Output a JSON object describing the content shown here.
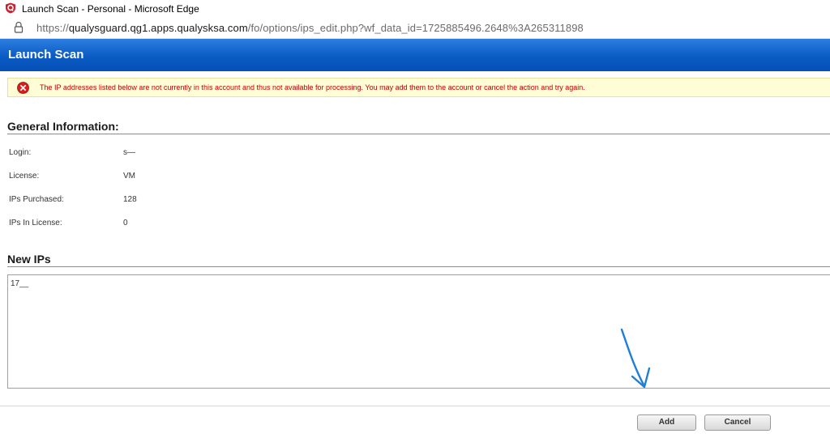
{
  "window": {
    "title": "Launch Scan - Personal - Microsoft Edge",
    "app_icon": "qualys-shield-icon"
  },
  "addressbar": {
    "url_prefix": "https://",
    "url_host": "qualysguard.qg1.apps.qualysksa.com",
    "url_path": "/fo/options/ips_edit.php?wf_data_id=1725885496.2648%3A265311898",
    "lock_icon": "lock-icon"
  },
  "header": {
    "title": "Launch Scan",
    "color": "#0a5bc4"
  },
  "alert": {
    "icon": "error-icon",
    "message": "The IP addresses listed below are not currently in this account and thus not available for processing. You may add them to the account or cancel the action and try again.",
    "text_color": "#c40000",
    "background": "#fffdd6"
  },
  "general_info": {
    "heading": "General Information:",
    "fields": [
      {
        "label": "Login:",
        "value": "s—"
      },
      {
        "label": "License:",
        "value": "VM"
      },
      {
        "label": "IPs Purchased:",
        "value": "128"
      },
      {
        "label": "IPs In License:",
        "value": "0"
      }
    ]
  },
  "new_ips": {
    "heading": "New IPs",
    "value": "17__"
  },
  "buttons": {
    "add_label": "Add",
    "cancel_label": "Cancel"
  },
  "annotation": {
    "arrow_icon": "annotation-arrow-icon",
    "color": "#1e7fd6"
  }
}
